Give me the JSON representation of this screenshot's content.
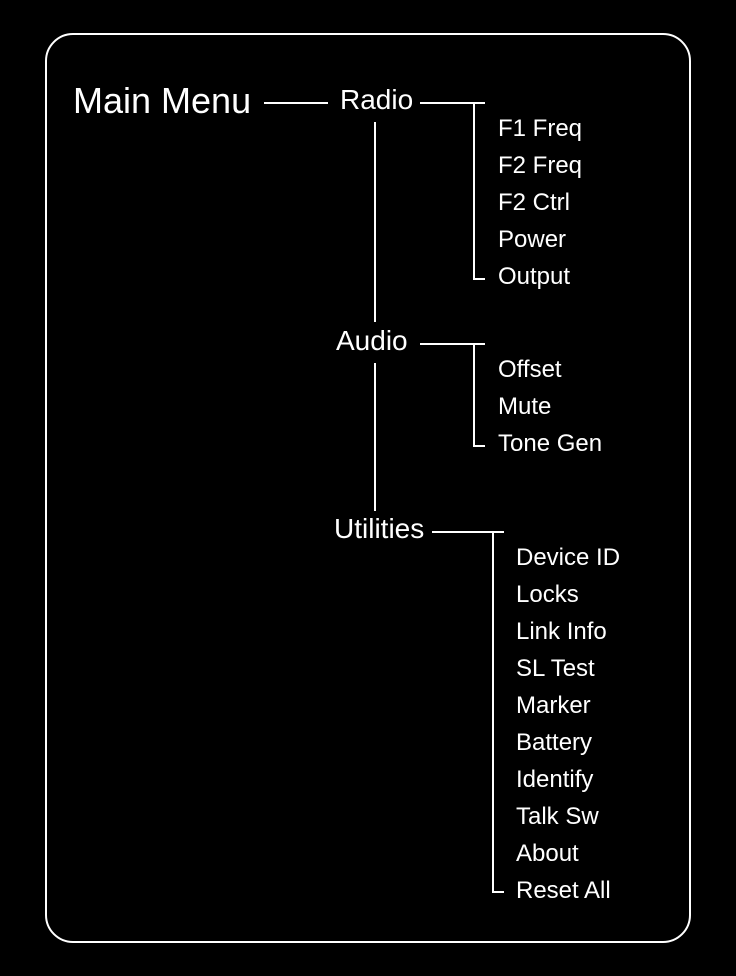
{
  "title": "Main Menu",
  "categories": [
    {
      "name": "Radio",
      "items": [
        "F1 Freq",
        "F2 Freq",
        "F2 Ctrl",
        "Power",
        "Output"
      ]
    },
    {
      "name": "Audio",
      "items": [
        "Offset",
        "Mute",
        "Tone Gen"
      ]
    },
    {
      "name": "Utilities",
      "items": [
        "Device ID",
        "Locks",
        "Link Info",
        "SL Test",
        "Marker",
        "Battery",
        "Identify",
        "Talk Sw",
        "About",
        "Reset All"
      ]
    }
  ]
}
